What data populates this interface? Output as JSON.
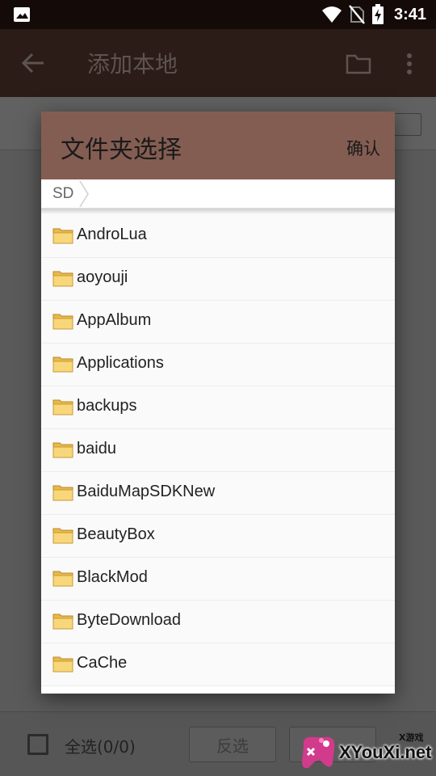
{
  "status_bar": {
    "time": "3:41",
    "icons": [
      "image-icon",
      "wifi-icon",
      "no-sim-icon",
      "battery-charging-icon"
    ]
  },
  "app_bar": {
    "title": "添加本地",
    "icons": [
      "back-arrow-icon",
      "folder-icon",
      "more-vert-icon"
    ]
  },
  "dialog": {
    "title": "文件夹选择",
    "confirm_label": "确认",
    "breadcrumb": "SD",
    "folders": [
      "AndroLua",
      "aoyouji",
      "AppAlbum",
      "Applications",
      "backups",
      "baidu",
      "BaiduMapSDKNew",
      "BeautyBox",
      "BlackMod",
      "ByteDownload",
      "CaChe"
    ]
  },
  "bottom_bar": {
    "select_all_label": "全选(0/0)",
    "invert_label": "反选"
  },
  "watermark": {
    "small": "X游戏",
    "big": "XYouXi.net"
  },
  "colors": {
    "status_bar": "#140b09",
    "app_bar": "#2c1c17",
    "dialog_header": "#845d52",
    "dim_overlay": "#5a5a5a"
  }
}
